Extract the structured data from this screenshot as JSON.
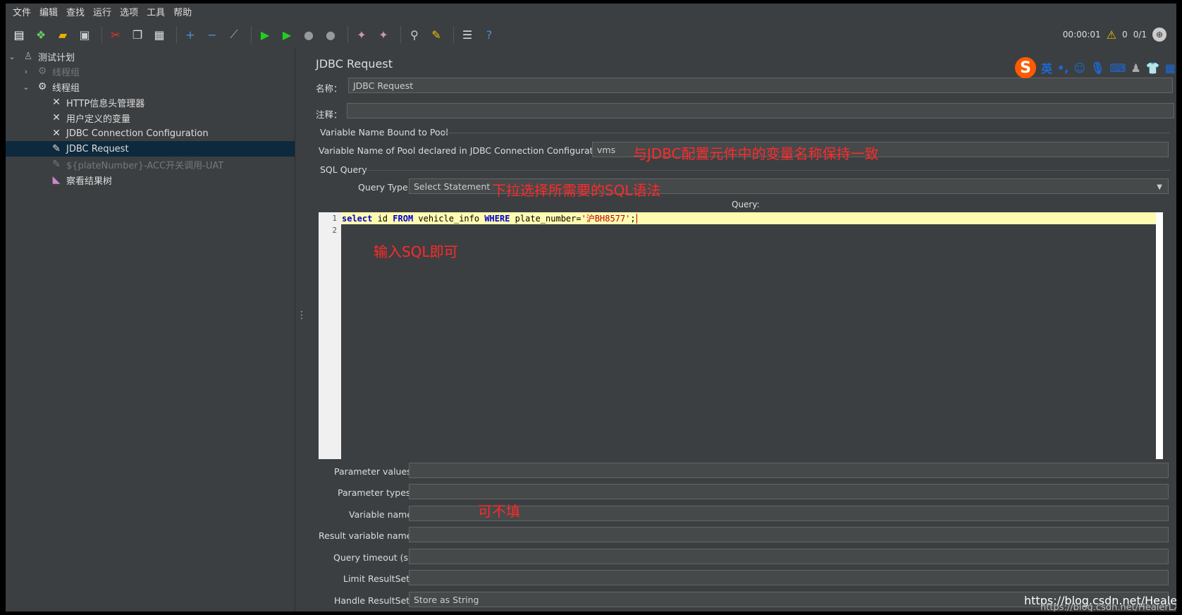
{
  "menu": [
    "文件",
    "编辑",
    "查找",
    "运行",
    "选项",
    "工具",
    "帮助"
  ],
  "toolbar_icons": [
    "new-icon",
    "templates-icon",
    "open-icon",
    "save-icon",
    "cut-icon",
    "copy-icon",
    "paste-icon",
    "expand-icon",
    "collapse-icon",
    "toggle-icon",
    "start-icon",
    "start-no-pause-icon",
    "stop-icon",
    "shutdown-icon",
    "clear-icon",
    "clear-all-icon",
    "search-icon",
    "reset-search-icon",
    "function-helper-icon",
    "help-icon"
  ],
  "status": {
    "timer": "00:00:01",
    "warnings": "0",
    "threads": "0/1"
  },
  "tree": [
    {
      "label": "测试计划",
      "icon": "test-plan-icon"
    },
    {
      "label": "线程组",
      "icon": "thread-group-icon"
    },
    {
      "label": "线程组",
      "icon": "thread-group-icon"
    },
    {
      "label": "HTTP信息头管理器",
      "icon": "config-element-icon"
    },
    {
      "label": "用户定义的变量",
      "icon": "config-element-icon"
    },
    {
      "label": "JDBC Connection Configuration",
      "icon": "config-element-icon"
    },
    {
      "label": "JDBC Request",
      "icon": "sampler-icon"
    },
    {
      "label": "${plateNumber}-ACC开关调用-UAT",
      "icon": "sampler-icon"
    },
    {
      "label": "察看结果树",
      "icon": "listener-icon"
    }
  ],
  "panel": {
    "title": "JDBC Request",
    "name_label": "名称：",
    "name_value": "JDBC Request",
    "comment_label": "注释：",
    "comment_value": "",
    "pool_section": "Variable Name Bound to Pool",
    "pool_label": "Variable Name of Pool declared in JDBC Connection Configuration:",
    "pool_value": "vms",
    "sql_section": "SQL Query",
    "query_type_label": "Query Type:",
    "query_type_value": "Select Statement",
    "query_label": "Query:",
    "line_numbers": [
      "1",
      "2"
    ],
    "sql": {
      "kw1": "select",
      "t1": " id ",
      "kw2": "FROM",
      "t2": " vehicle_info ",
      "kw3": "WHERE",
      "t3": " plate_number=",
      "str": "'沪BH8577'",
      "t4": ";"
    },
    "param_values_label": "Parameter values:",
    "param_types_label": "Parameter types:",
    "variable_names_label": "Variable names:",
    "result_var_label": "Result variable name:",
    "timeout_label": "Query timeout (s):",
    "limit_label": "Limit ResultSet:",
    "handle_label": "Handle ResultSet:",
    "handle_value": "Store as String"
  },
  "annotations": {
    "pool": "与JDBC配置元件中的变量名称保持一致",
    "query_type": "下拉选择所需要的SQL语法",
    "sql": "输入SQL即可",
    "optional": "可不填"
  },
  "ime": {
    "mode": "英",
    "punct": "•,"
  },
  "watermark": "https://blog.csdn.net/HealerLX",
  "watermark2": "https://blog.csdn.net/HealerLX"
}
